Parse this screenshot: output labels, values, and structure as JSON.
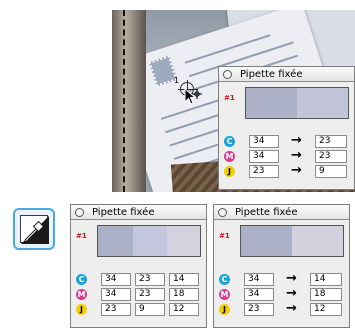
{
  "panel_title": "Pipette fixée",
  "sample_label": "#1",
  "cursor_number": "1",
  "ink_badges": [
    "C",
    "M",
    "J"
  ],
  "arrow_glyph": "→",
  "colors": {
    "cyan": "#1aa4d8",
    "magenta": "#d83a8c",
    "yellow": "#f0d000",
    "sample_red": "#d01212",
    "tool_border": "#4aa8e0"
  },
  "panels": {
    "top": {
      "swatches": [
        "#aeb2c8",
        "#c2c5d8"
      ],
      "rows": [
        {
          "ink": "C",
          "from": "34",
          "to": "23"
        },
        {
          "ink": "M",
          "from": "34",
          "to": "23"
        },
        {
          "ink": "J",
          "from": "23",
          "to": "9"
        }
      ]
    },
    "bottom_left": {
      "swatches": [
        "#acb0c6",
        "#c3c6dc",
        "#d3d2de"
      ],
      "rows": [
        {
          "ink": "C",
          "a": "34",
          "b": "23",
          "c": "14"
        },
        {
          "ink": "M",
          "a": "34",
          "b": "23",
          "c": "18"
        },
        {
          "ink": "J",
          "a": "23",
          "b": "9",
          "c": "12"
        }
      ]
    },
    "bottom_right": {
      "swatches": [
        "#adb1c7",
        "#d2d1dd"
      ],
      "rows": [
        {
          "ink": "C",
          "from": "34",
          "to": "14"
        },
        {
          "ink": "M",
          "from": "34",
          "to": "18"
        },
        {
          "ink": "J",
          "from": "23",
          "to": "12"
        }
      ]
    }
  },
  "icons": {
    "tool": "fixed-eyedropper-tool-icon",
    "close": "close-circle-icon",
    "cursor": "eyedropper-cursor-icon"
  }
}
